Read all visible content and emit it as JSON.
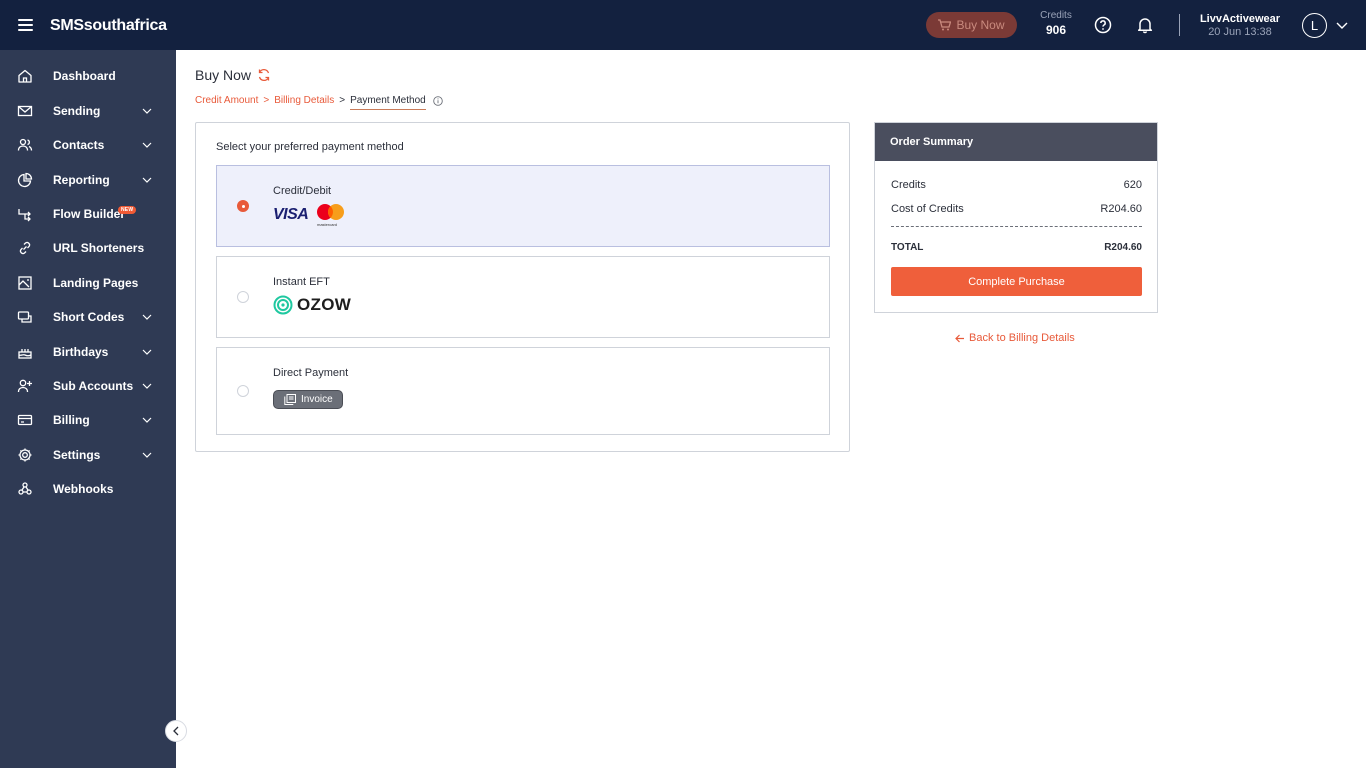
{
  "header": {
    "brand": "SMSsouthafrica",
    "buy_now_label": "Buy Now",
    "credits_label": "Credits",
    "credits_value": "906",
    "user_name": "LivvActivewear",
    "user_date": "20 Jun 13:38",
    "avatar_initial": "L"
  },
  "sidebar": {
    "items": [
      {
        "label": "Dashboard",
        "icon": "home-icon"
      },
      {
        "label": "Sending",
        "icon": "mail-icon"
      },
      {
        "label": "Contacts",
        "icon": "contacts-icon"
      },
      {
        "label": "Reporting",
        "icon": "pie-chart-icon"
      },
      {
        "label": "Flow Builder",
        "icon": "flow-icon",
        "badge": "NEW"
      },
      {
        "label": "URL Shorteners",
        "icon": "link-icon"
      },
      {
        "label": "Landing Pages",
        "icon": "landing-page-icon"
      },
      {
        "label": "Short Codes",
        "icon": "short-codes-icon"
      },
      {
        "label": "Birthdays",
        "icon": "cake-icon"
      },
      {
        "label": "Sub Accounts",
        "icon": "add-user-icon"
      },
      {
        "label": "Billing",
        "icon": "card-icon"
      },
      {
        "label": "Settings",
        "icon": "gear-icon"
      },
      {
        "label": "Webhooks",
        "icon": "webhook-icon"
      }
    ]
  },
  "main": {
    "title": "Buy Now",
    "breadcrumb": {
      "step1": "Credit Amount",
      "step2": "Billing Details",
      "step3": "Payment Method",
      "sep": ">"
    },
    "payment": {
      "heading": "Select your preferred payment method",
      "options": [
        {
          "label": "Credit/Debit",
          "brand": "VISA",
          "selected": true
        },
        {
          "label": "Instant EFT",
          "brand": "OZOW",
          "selected": false
        },
        {
          "label": "Direct Payment",
          "brand": "Invoice",
          "selected": false
        }
      ],
      "mastercard_caption": "mastercard"
    }
  },
  "summary": {
    "title": "Order Summary",
    "credits_label": "Credits",
    "credits_value": "620",
    "cost_label": "Cost of Credits",
    "cost_value": "R204.60",
    "total_label": "TOTAL",
    "total_value": "R204.60",
    "complete_label": "Complete Purchase",
    "back_label": "Back to Billing Details"
  },
  "colors": {
    "accent": "#ef5f3b",
    "topbar": "#13213f",
    "sidebar": "#2f3a54",
    "summary_header": "#4a4e5e",
    "selected_option": "#eef0fb"
  }
}
